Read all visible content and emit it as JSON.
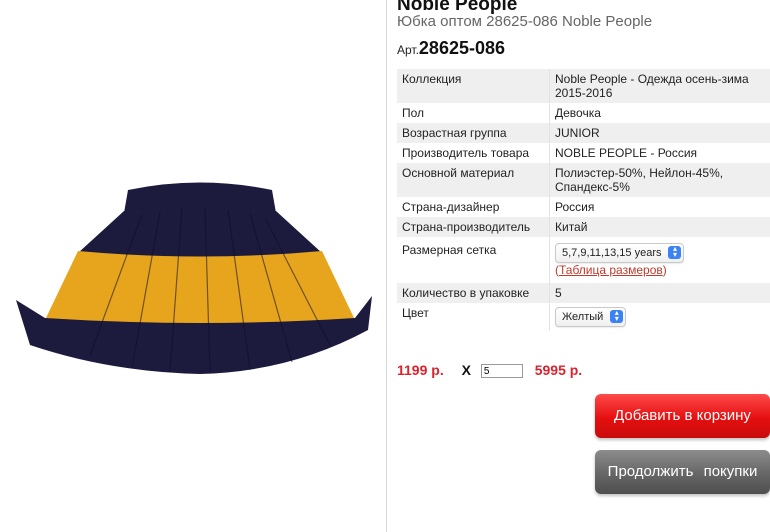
{
  "product": {
    "brand": "Noble People",
    "title": "Юбка оптом 28625-086 Noble People",
    "art_label": "Арт.",
    "art_value": "28625-086"
  },
  "specs": [
    {
      "label": "Коллекция",
      "value": "Noble People - Одежда осень-зима 2015-2016"
    },
    {
      "label": "Пол",
      "value": "Девочка"
    },
    {
      "label": "Возрастная группа",
      "value": "JUNIOR"
    },
    {
      "label": "Производитель товара",
      "value": "NOBLE PEOPLE - Россия"
    },
    {
      "label": "Основной материал",
      "value": "Полиэстер-50%, Нейлон-45%, Спандекс-5%"
    },
    {
      "label": "Страна-дизайнер",
      "value": "Россия"
    },
    {
      "label": "Страна-производитель",
      "value": "Китай"
    },
    {
      "label": "Размерная сетка",
      "size_select": "5,7,9,11,13,15 years",
      "link_open": "(",
      "link_text": "Таблица размеров",
      "link_close": ")"
    },
    {
      "label": "Количество в упаковке",
      "value": "5"
    },
    {
      "label": "Цвет",
      "color_select": "Желтый"
    }
  ],
  "pricing": {
    "unit_price": "1199 р.",
    "multiply": "X",
    "quantity": "5",
    "total": "5995 р."
  },
  "buttons": {
    "add_to_cart": "Добавить в корзину",
    "continue": "Продолжить покупки"
  },
  "colors": {
    "price_red": "#d9232d",
    "cart_button": "#e50f10",
    "continue_button": "#666666",
    "skirt_navy": "#1c1a3d",
    "skirt_yellow": "#e6a51c"
  }
}
